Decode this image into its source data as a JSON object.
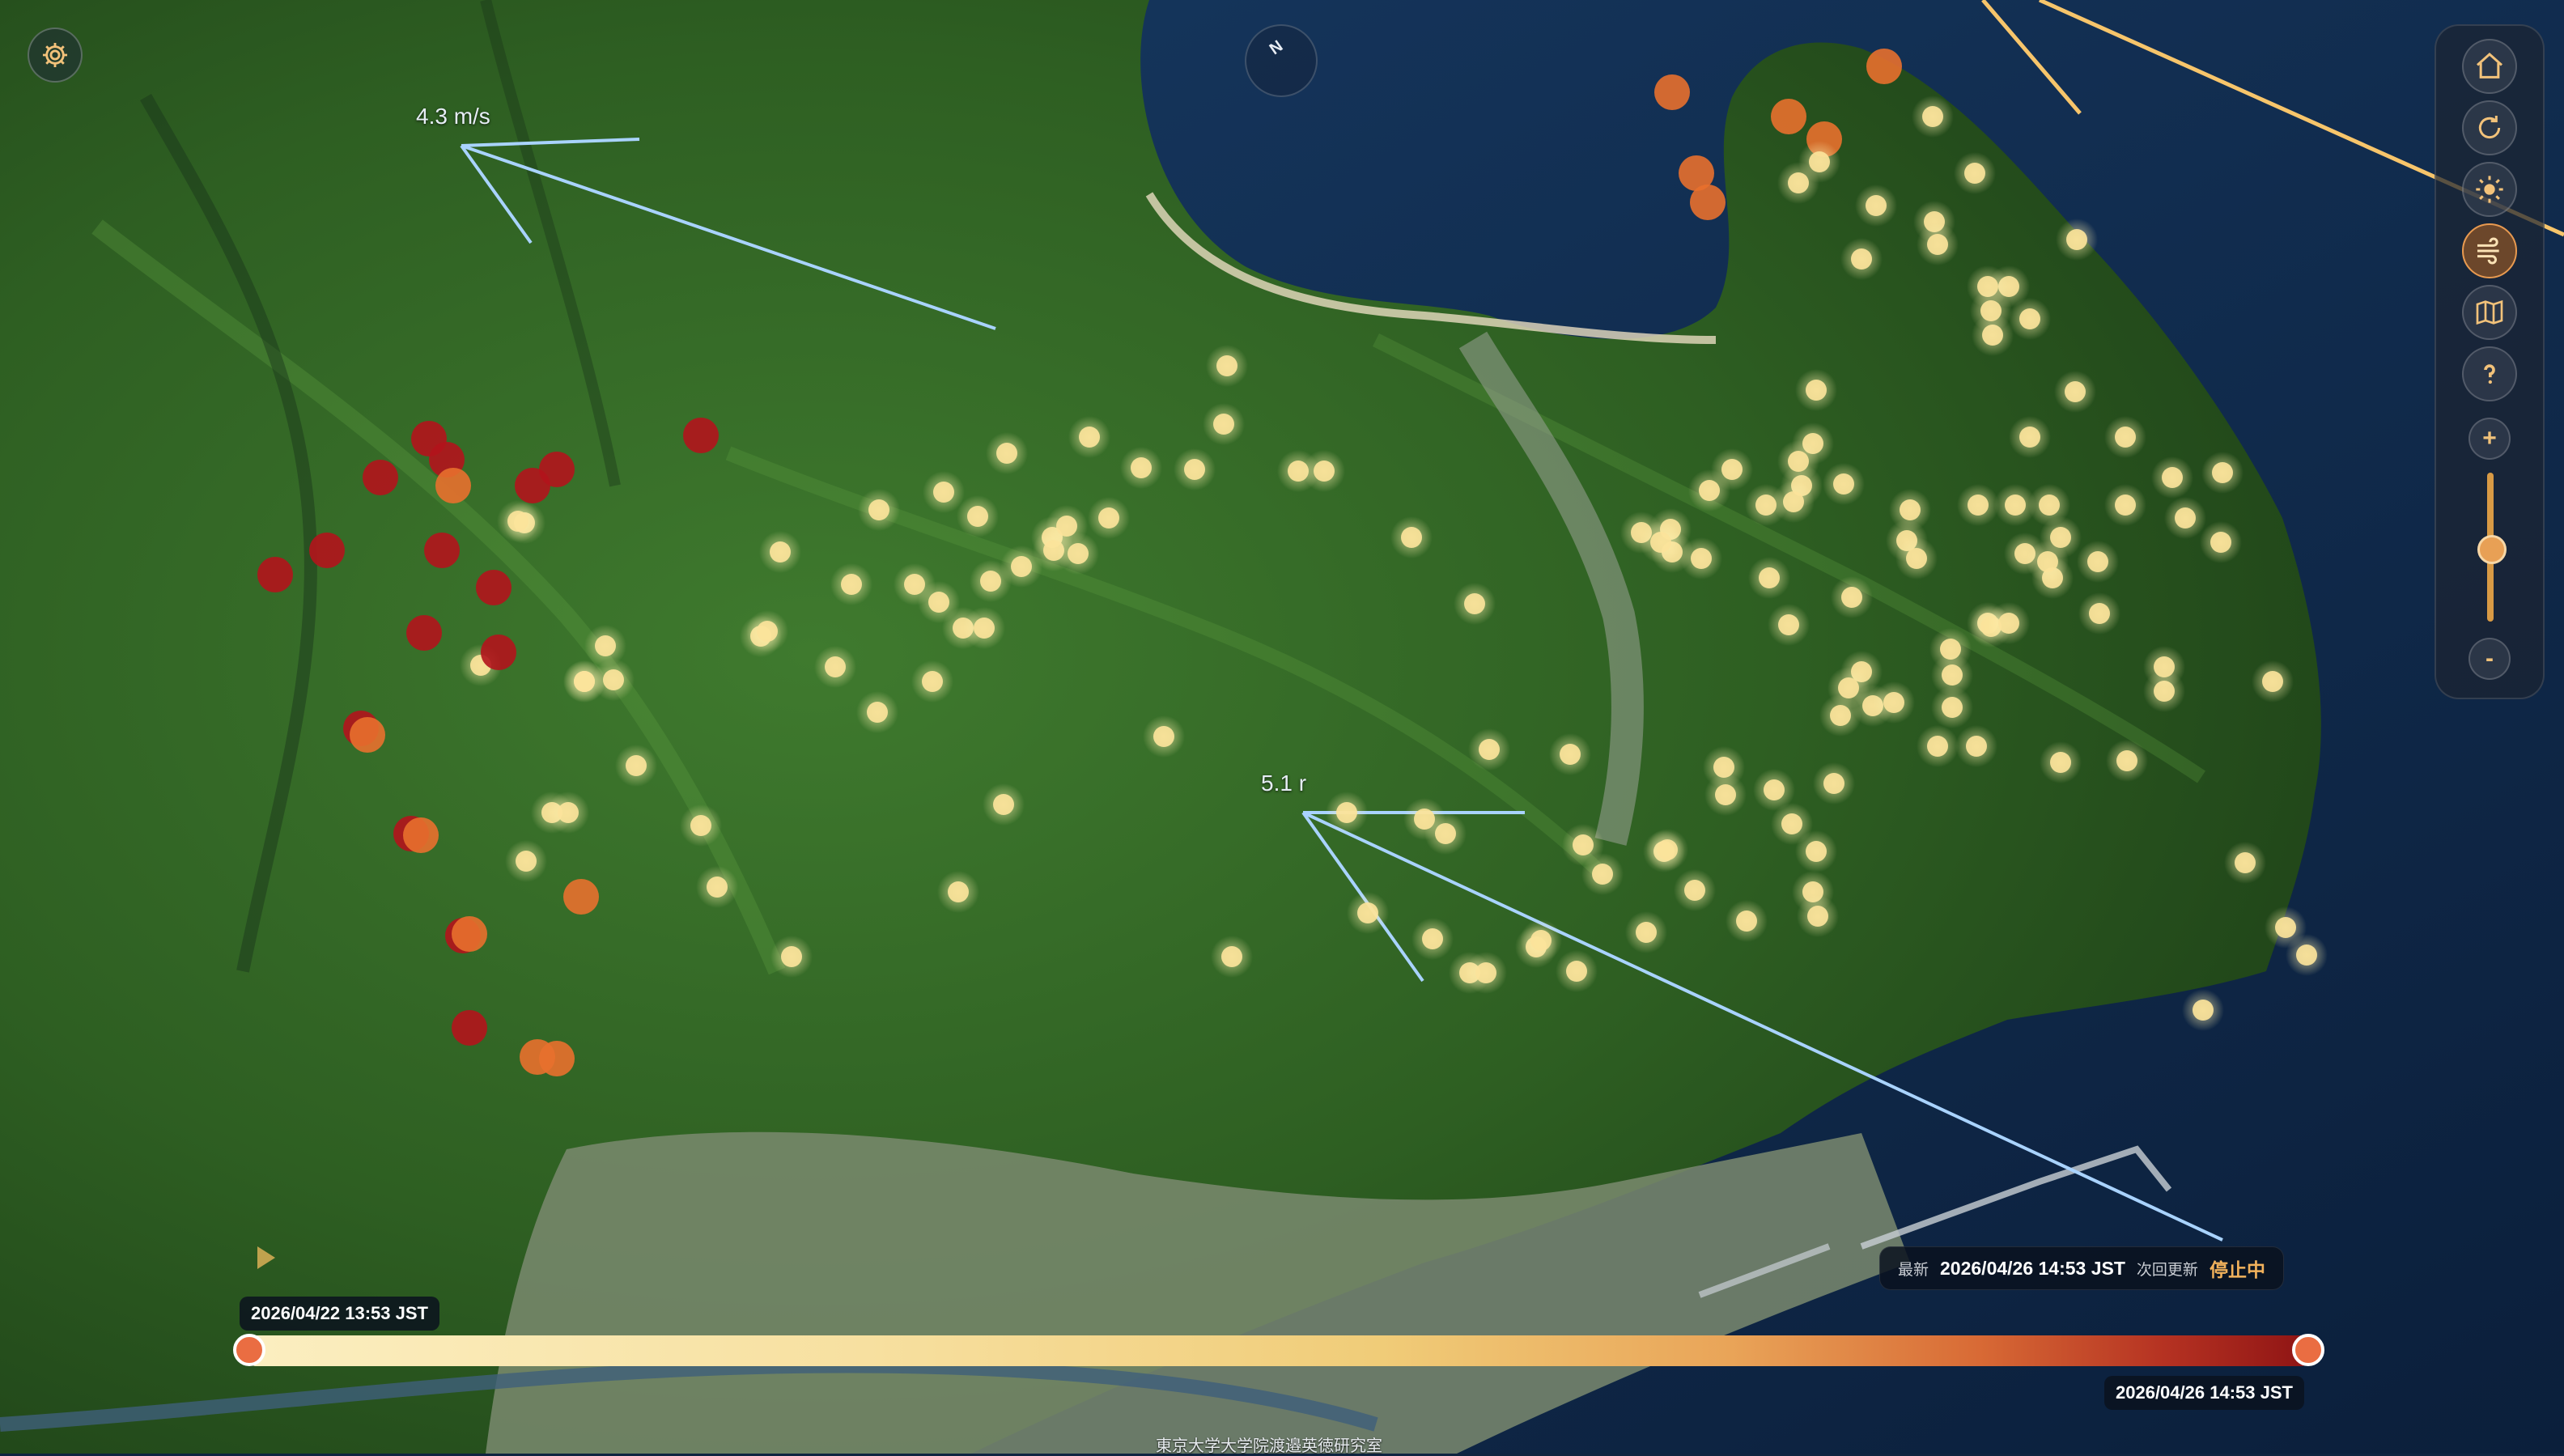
{
  "wind": {
    "upper_label": "4.3 m/s",
    "lower_label": "5.1 r"
  },
  "compass": {
    "label": "N"
  },
  "toolbar": {
    "buttons": [
      {
        "icon": "home-icon"
      },
      {
        "icon": "refresh-icon"
      },
      {
        "icon": "sun-icon"
      },
      {
        "icon": "wind-icon",
        "active": true
      },
      {
        "icon": "map-icon"
      },
      {
        "icon": "help-icon"
      }
    ],
    "zoom_in_label": "+",
    "zoom_out_label": "-",
    "zoom_level": 0.5
  },
  "status": {
    "latest_key": "最新",
    "latest_value": "2026/04/26 14:53 JST",
    "next_key": "次回更新",
    "next_value": "停止中"
  },
  "timeline": {
    "start_label": "2026/04/22 13:53 JST",
    "end_label": "2026/04/26 14:53 JST",
    "start_pos": 0,
    "end_pos": 1
  },
  "credit": "東京大学大学院渡邉英徳研究室",
  "colors": {
    "dot_recent": "#fbe39a",
    "dot_mid": "#e8702e",
    "dot_old": "#b3141c",
    "wind_line": "#a9d3ff",
    "accent": "#e89a50"
  },
  "map_icons": {
    "settings": "gear-icon",
    "play": "play-icon"
  }
}
